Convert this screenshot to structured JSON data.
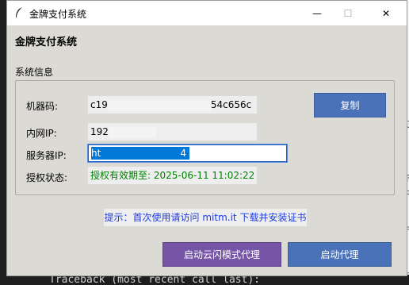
{
  "window": {
    "title": "金牌支付系统",
    "controls": {
      "minimize": "—",
      "maximize": "☐",
      "close": "✕"
    }
  },
  "app_title": "金牌支付系统",
  "section_label": "系统信息",
  "info": {
    "machine_code": {
      "label": "机器码:",
      "value_start": "c19",
      "value_end": "54c656c"
    },
    "lan_ip": {
      "label": "内网IP:",
      "value_start": "192"
    },
    "server_ip": {
      "label": "服务器IP:",
      "value_start": "ht",
      "value_end": "4"
    },
    "license_status": {
      "label": "授权状态:",
      "value": "授权有效期至: 2025-06-11 11:02:22"
    }
  },
  "copy_button": "复制",
  "hint": "提示：首次使用请访问 mitm.it 下载并安装证书",
  "buttons": {
    "cloud_proxy": "启动云闪模式代理",
    "start_proxy": "启动代理"
  },
  "background": {
    "terminal_line": "Traceback (most recent call last):",
    "right_edge_chars": [
      "23",
      "你",
      "中",
      "宁",
      "23"
    ]
  },
  "colors": {
    "window_bg": "#dcdad5",
    "accent_blue": "#4a72b8",
    "accent_purple": "#7654a6",
    "license_green": "#008000",
    "hint_blue": "#1e3de0"
  }
}
